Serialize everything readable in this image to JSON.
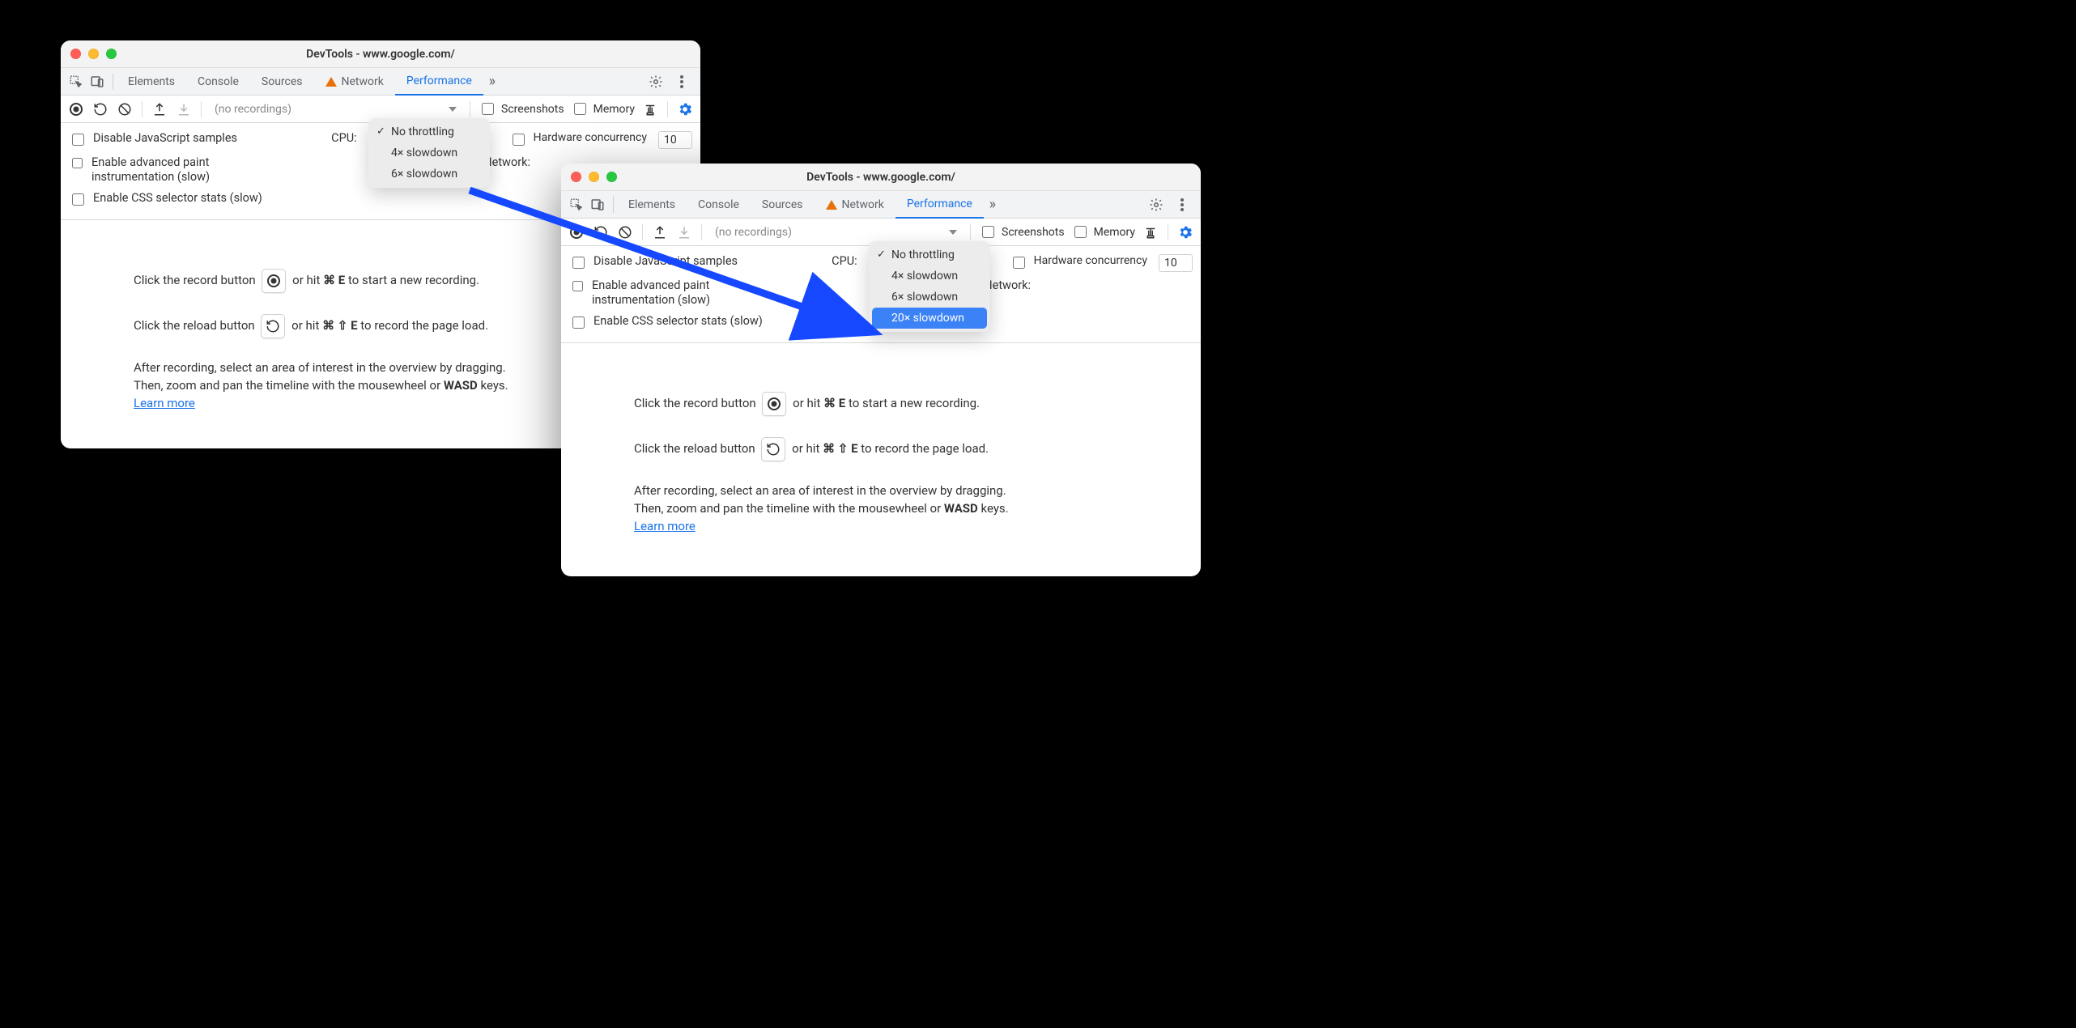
{
  "windows": {
    "left": {
      "title": "DevTools - www.google.com/",
      "tabs": [
        "Elements",
        "Console",
        "Sources",
        "Network",
        "Performance"
      ],
      "activeTab": "Performance",
      "toolbar": {
        "recordings_placeholder": "(no recordings)",
        "screenshots_label": "Screenshots",
        "memory_label": "Memory"
      },
      "settings": {
        "disable_js": "Disable JavaScript samples",
        "adv_paint": "Enable advanced paint instrumentation (slow)",
        "css_stats": "Enable CSS selector stats (slow)",
        "cpu_label": "CPU:",
        "network_label": "Network:",
        "hw_label": "Hardware concurrency",
        "hw_value": "10"
      },
      "cpu_dropdown": {
        "option0": "No throttling",
        "option1": "4× slowdown",
        "option2": "6× slowdown"
      },
      "help": {
        "record_line_a": "Click the record button ",
        "record_line_b": " or hit ",
        "record_shortcut": "⌘ E",
        "record_line_c": " to start a new recording.",
        "reload_line_a": "Click the reload button ",
        "reload_line_b": " or hit ",
        "reload_shortcut": "⌘ ⇧ E",
        "reload_line_c": " to record the page load.",
        "after_a": "After recording, select an area of interest in the overview by dragging.",
        "after_b_a": "Then, zoom and pan the timeline with the mousewheel or ",
        "after_b_b": "WASD",
        "after_b_c": " keys.",
        "learn_more": "Learn more"
      }
    },
    "right": {
      "title": "DevTools - www.google.com/",
      "tabs": [
        "Elements",
        "Console",
        "Sources",
        "Network",
        "Performance"
      ],
      "activeTab": "Performance",
      "toolbar": {
        "recordings_placeholder": "(no recordings)",
        "screenshots_label": "Screenshots",
        "memory_label": "Memory"
      },
      "settings": {
        "disable_js": "Disable JavaScript samples",
        "adv_paint": "Enable advanced paint instrumentation (slow)",
        "css_stats": "Enable CSS selector stats (slow)",
        "cpu_label": "CPU:",
        "network_label": "Network:",
        "hw_label": "Hardware concurrency",
        "hw_value": "10"
      },
      "cpu_dropdown": {
        "option0": "No throttling",
        "option1": "4× slowdown",
        "option2": "6× slowdown",
        "option3": "20× slowdown"
      },
      "help": {
        "record_line_a": "Click the record button ",
        "record_line_b": " or hit ",
        "record_shortcut": "⌘ E",
        "record_line_c": " to start a new recording.",
        "reload_line_a": "Click the reload button ",
        "reload_line_b": " or hit ",
        "reload_shortcut": "⌘ ⇧ E",
        "reload_line_c": " to record the page load.",
        "after_a": "After recording, select an area of interest in the overview by dragging.",
        "after_b_a": "Then, zoom and pan the timeline with the mousewheel or ",
        "after_b_b": "WASD",
        "after_b_c": " keys.",
        "learn_more": "Learn more"
      }
    }
  }
}
